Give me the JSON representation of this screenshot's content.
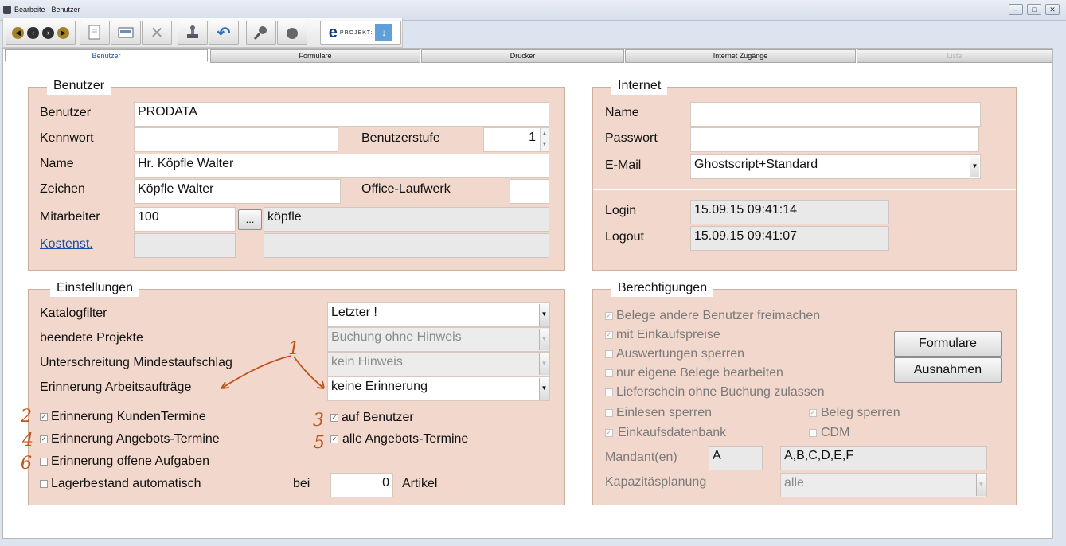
{
  "window": {
    "title": "Bearbeite - Benutzer"
  },
  "toolbar": {
    "logo_e": "e",
    "logo_text": "PROJEKT:"
  },
  "tabs": [
    {
      "label": "Benutzer",
      "active": true
    },
    {
      "label": "Formulare"
    },
    {
      "label": "Drucker"
    },
    {
      "label": "Internet Zugänge"
    },
    {
      "label": "Liste",
      "disabled": true
    }
  ],
  "benutzer": {
    "legend": "Benutzer",
    "benutzer_label": "Benutzer",
    "benutzer_value": "PRODATA",
    "kennwort_label": "Kennwort",
    "kennwort_value": "",
    "benutzerstufe_label": "Benutzerstufe",
    "benutzerstufe_value": "1",
    "name_label": "Name",
    "name_value": "Hr. Köpfle Walter",
    "zeichen_label": "Zeichen",
    "zeichen_value": "Köpfle Walter",
    "office_label": "Office-Laufwerk",
    "office_value": "",
    "mitarbeiter_label": "Mitarbeiter",
    "mitarbeiter_value": "100",
    "mitarbeiter_button": "...",
    "mitarbeiter_name": "köpfle",
    "kostenst_label": "Kostenst."
  },
  "internet": {
    "legend": "Internet",
    "name_label": "Name",
    "passwort_label": "Passwort",
    "email_label": "E-Mail",
    "email_value": "Ghostscript+Standard",
    "login_label": "Login",
    "login_value": "15.09.15 09:41:14",
    "logout_label": "Logout",
    "logout_value": "15.09.15 09:41:07"
  },
  "einstellungen": {
    "legend": "Einstellungen",
    "katalogfilter_label": "Katalogfilter",
    "katalogfilter_value": "Letzter !",
    "beendete_label": "beendete Projekte",
    "beendete_value": "Buchung ohne Hinweis",
    "unterschreitung_label": "Unterschreitung Mindestaufschlag",
    "unterschreitung_value": "kein Hinweis",
    "erinnerung_label": "Erinnerung Arbeitsaufträge",
    "erinnerung_value": "keine Erinnerung",
    "checkboxes": [
      {
        "label": "Erinnerung KundenTermine",
        "checked": true
      },
      {
        "label": "Erinnerung Angebots-Termine",
        "checked": true
      },
      {
        "label": "Erinnerung offene Aufgaben",
        "checked": false
      },
      {
        "label": "Lagerbestand automatisch",
        "checked": false
      }
    ],
    "auf_benutzer": {
      "label": "auf Benutzer",
      "checked": true
    },
    "alle_angebots": {
      "label": "alle Angebots-Termine",
      "checked": true
    },
    "bei_label": "bei",
    "bei_value": "0",
    "artikel_label": "Artikel"
  },
  "berechtigungen": {
    "legend": "Berechtigungen",
    "items": [
      {
        "label": "Belege andere Benutzer freimachen",
        "checked": true
      },
      {
        "label": "mit Einkaufspreise",
        "checked": true
      },
      {
        "label": "Auswertungen sperren",
        "checked": false
      },
      {
        "label": "nur eigene Belege bearbeiten",
        "checked": false
      },
      {
        "label": "Lieferschein ohne Buchung zulassen",
        "checked": false
      },
      {
        "label": "Einlesen sperren",
        "checked": false
      },
      {
        "label": "Beleg sperren",
        "checked": true
      },
      {
        "label": "Einkaufsdatenbank",
        "checked": true
      },
      {
        "label": "CDM",
        "checked": false
      }
    ],
    "formulare_button": "Formulare",
    "ausnahmen_button": "Ausnahmen",
    "mandant_label": "Mandant(en)",
    "mandant_value": "A",
    "mandant_list": "A,B,C,D,E,F",
    "kapazitaet_label": "Kapazitäsplanung",
    "kapazitaet_value": "alle"
  },
  "annotations": {
    "n1": "1",
    "n2": "2",
    "n3": "3",
    "n4": "4",
    "n5": "5",
    "n6": "6",
    "color": "#c0521a"
  }
}
